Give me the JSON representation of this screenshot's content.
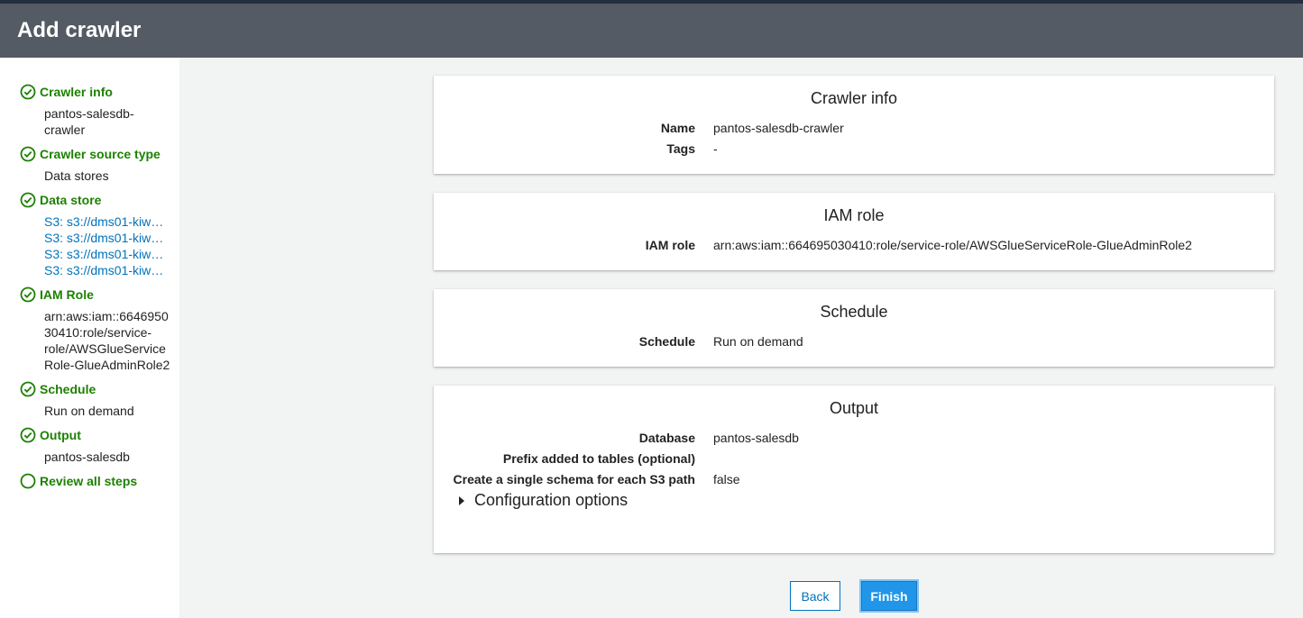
{
  "header": {
    "title": "Add crawler"
  },
  "sidebar": {
    "steps": [
      {
        "title": "Crawler info",
        "sub": [
          "pantos-salesdb-",
          "crawler"
        ],
        "done": true
      },
      {
        "title": "Crawler source type",
        "sub": [
          "Data stores"
        ],
        "done": true
      },
      {
        "title": "Data store",
        "links": [
          "S3: s3://dms01-kiw…",
          "S3: s3://dms01-kiw…",
          "S3: s3://dms01-kiw…",
          "S3: s3://dms01-kiw…"
        ],
        "done": true
      },
      {
        "title": "IAM Role",
        "sub": [
          "arn:aws:iam::6646950",
          "30410:role/service-",
          "role/AWSGlueService",
          "Role-GlueAdminRole2"
        ],
        "done": true
      },
      {
        "title": "Schedule",
        "sub": [
          "Run on demand"
        ],
        "done": true
      },
      {
        "title": "Output",
        "sub": [
          "pantos-salesdb"
        ],
        "done": true
      },
      {
        "title": "Review all steps",
        "done": false
      }
    ]
  },
  "cards": {
    "crawler_info": {
      "title": "Crawler info",
      "rows": [
        {
          "label": "Name",
          "value": "pantos-salesdb-crawler"
        },
        {
          "label": "Tags",
          "value": "-"
        }
      ]
    },
    "iam_role": {
      "title": "IAM role",
      "rows": [
        {
          "label": "IAM role",
          "value": "arn:aws:iam::664695030410:role/service-role/AWSGlueServiceRole-GlueAdminRole2"
        }
      ]
    },
    "schedule": {
      "title": "Schedule",
      "rows": [
        {
          "label": "Schedule",
          "value": "Run on demand"
        }
      ]
    },
    "output": {
      "title": "Output",
      "rows": [
        {
          "label": "Database",
          "value": "pantos-salesdb"
        },
        {
          "label": "Prefix added to tables (optional)",
          "value": ""
        },
        {
          "label": "Create a single schema for each S3 path",
          "value": "false"
        }
      ],
      "config_label": "Configuration options"
    }
  },
  "buttons": {
    "back": "Back",
    "finish": "Finish"
  },
  "colors": {
    "header_bg": "#545b64",
    "step_green": "#1d8102",
    "link_blue": "#0073bb",
    "primary_blue": "#2196e8"
  }
}
